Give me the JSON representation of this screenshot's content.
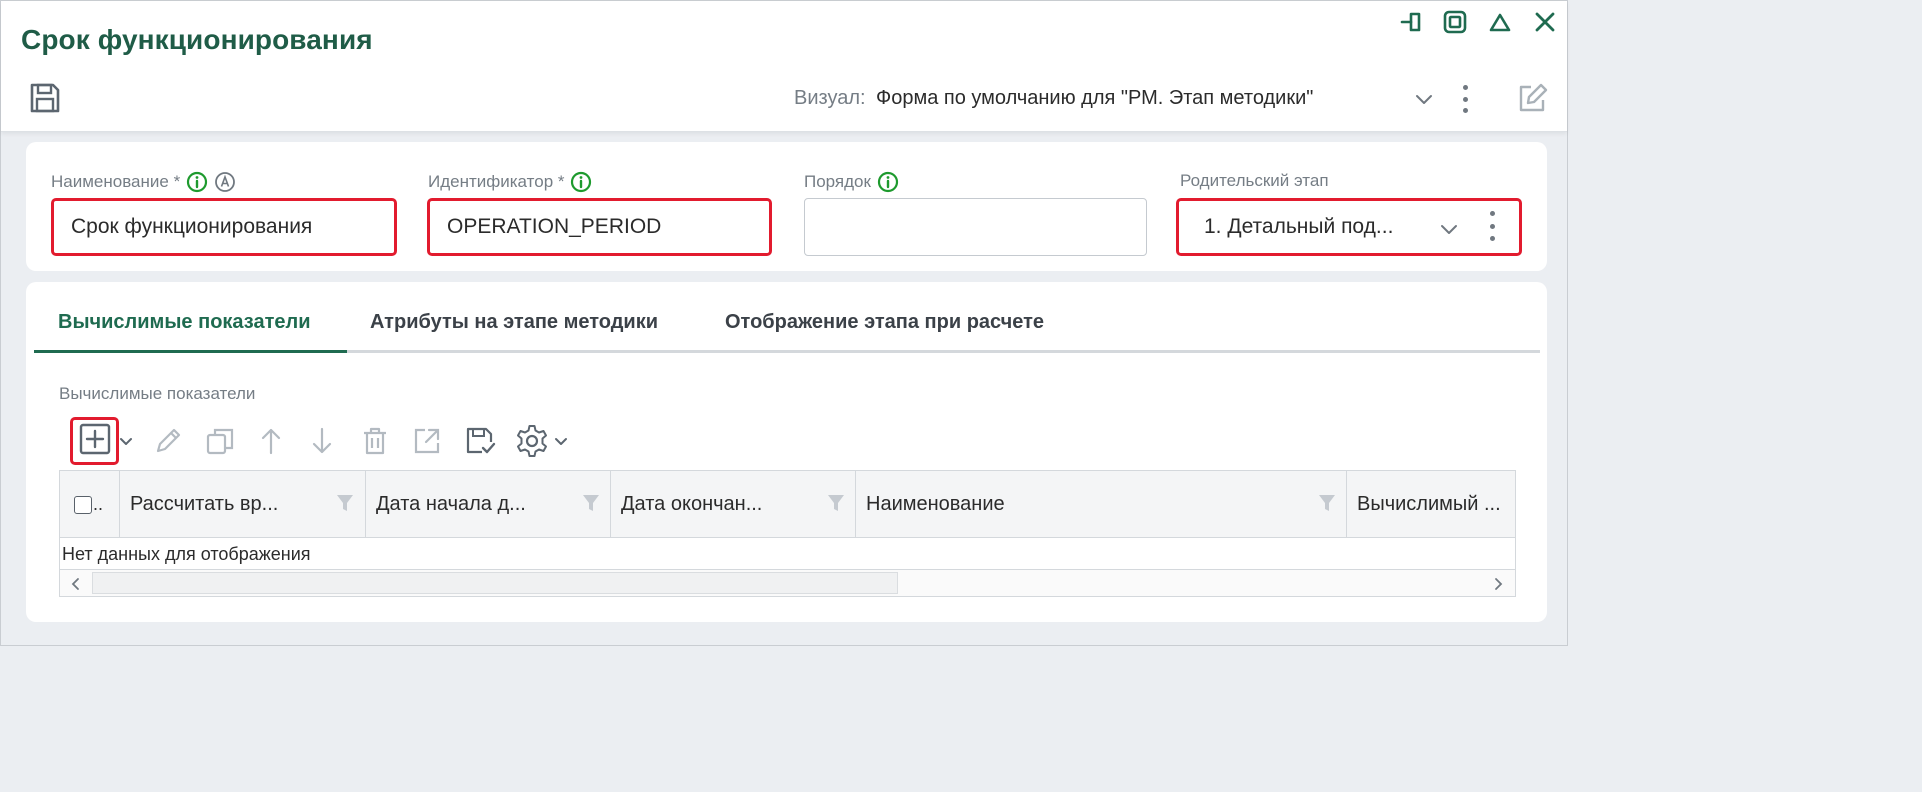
{
  "window": {
    "title": "Срок функционирования",
    "controls": [
      "pin-icon",
      "restore-icon",
      "collapse-icon",
      "close-icon"
    ]
  },
  "header": {
    "visual_label": "Визуал:",
    "visual_value": "Форма по умолчанию для \"РМ. Этап методики\""
  },
  "fields": {
    "name": {
      "label": "Наименование *",
      "value": "Срок функционирования",
      "error": true
    },
    "identifier": {
      "label": "Идентификатор *",
      "value": "OPERATION_PERIOD",
      "error": true
    },
    "order": {
      "label": "Порядок",
      "value": "",
      "error": false
    },
    "parent": {
      "label": "Родительский этап",
      "value": "1. Детальный под...",
      "error": true
    }
  },
  "tabs": [
    {
      "label": "Вычислимые показатели",
      "active": true
    },
    {
      "label": "Атрибуты на этапе методики",
      "active": false
    },
    {
      "label": "Отображение этапа при расчете",
      "active": false
    }
  ],
  "section": {
    "label": "Вычислимые показатели"
  },
  "toolbar": [
    "add-icon",
    "edit-icon",
    "copy-icon",
    "move-up-icon",
    "move-down-icon",
    "delete-icon",
    "open-icon",
    "save-icon",
    "settings-icon"
  ],
  "grid": {
    "columns": [
      "Рассчитать вр...",
      "Дата начала д...",
      "Дата окончан...",
      "Наименование",
      "Вычислимый ..."
    ],
    "select_all": "..",
    "empty_text": "Нет данных для отображения"
  },
  "colors": {
    "accent": "#1f6b50",
    "error": "#e21b2e",
    "title": "#1f5c47"
  }
}
